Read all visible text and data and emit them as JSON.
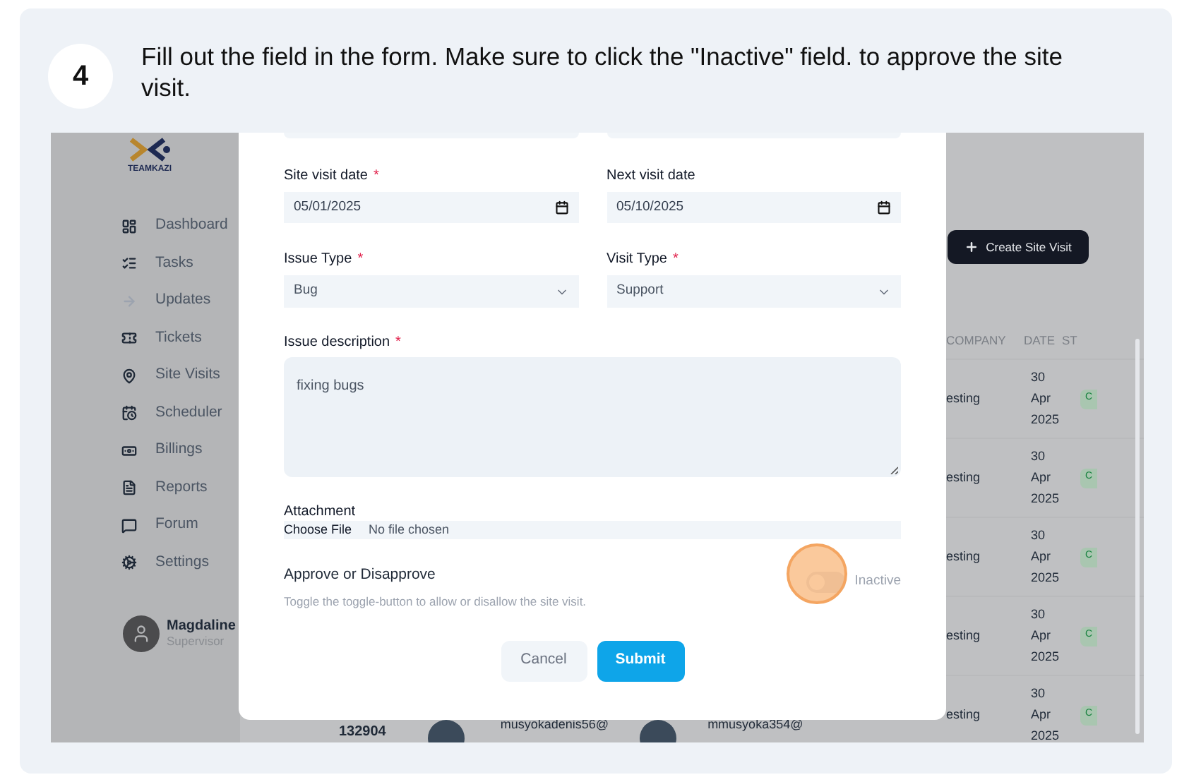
{
  "step": {
    "number": "4",
    "text": "Fill out the field in the form. Make sure to click the \"Inactive\" field. to approve the site visit."
  },
  "app": {
    "logo": {
      "name": "TEAMKAZI"
    },
    "sidebar": {
      "items": [
        {
          "label": "Dashboard"
        },
        {
          "label": "Tasks"
        },
        {
          "label": "Updates"
        },
        {
          "label": "Tickets"
        },
        {
          "label": "Site Visits"
        },
        {
          "label": "Scheduler"
        },
        {
          "label": "Billings"
        },
        {
          "label": "Reports"
        },
        {
          "label": "Forum"
        },
        {
          "label": "Settings"
        }
      ]
    },
    "user": {
      "name": "Magdaline",
      "role": "Supervisor"
    },
    "create_button": "Create Site Visit",
    "table": {
      "columns": [
        "COMPANY",
        "DATE",
        "ST"
      ],
      "rows": [
        {
          "company": "esting",
          "date": "30 Apr 2025",
          "status": "C"
        },
        {
          "company": "esting",
          "date": "30 Apr 2025",
          "status": "C"
        },
        {
          "company": "esting",
          "date": "30 Apr 2025",
          "status": "C"
        },
        {
          "company": "esting",
          "date": "30 Apr 2025",
          "status": "C"
        }
      ],
      "last_row": {
        "id": "132904",
        "email_1": "musyokadenis56@",
        "email_2": "mmusyoka354@",
        "company": "esting",
        "date": "30 Apr 2025",
        "status": "C"
      }
    }
  },
  "modal": {
    "date_fields": [
      {
        "label": "Site visit date",
        "required_mark": "*",
        "value": "05/01/2025"
      },
      {
        "label": "Next visit date",
        "value": "05/10/2025"
      }
    ],
    "select_fields": [
      {
        "label": "Issue Type",
        "required_mark": "*",
        "value": "Bug"
      },
      {
        "label": "Visit Type",
        "required_mark": "*",
        "value": "Support"
      }
    ],
    "description": {
      "label": "Issue description",
      "required_mark": "*",
      "value": "fixing bugs"
    },
    "attachment": {
      "label": "Attachment",
      "button": "Choose File",
      "status": "No file chosen"
    },
    "approval": {
      "label": "Approve or Disapprove",
      "hint": "Toggle the toggle-button to allow or disallow the site visit.",
      "on": false,
      "state_label": "Inactive"
    },
    "buttons": {
      "cancel": "Cancel",
      "submit": "Submit"
    }
  }
}
